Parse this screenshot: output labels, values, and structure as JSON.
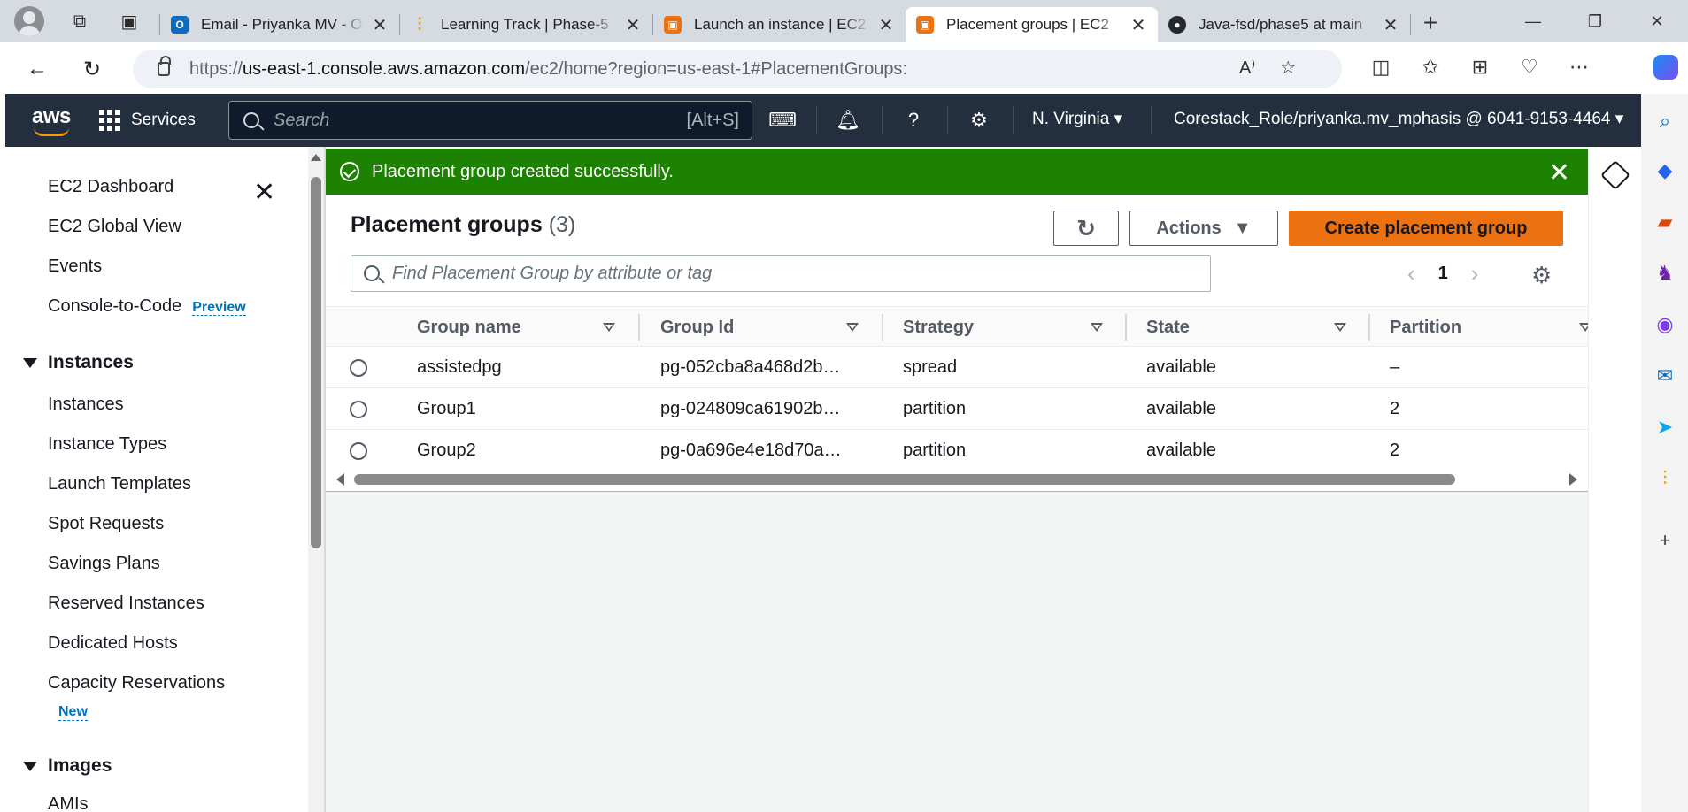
{
  "browser": {
    "tabs": [
      {
        "title": "Email - Priyanka MV - Outlook",
        "favicon": "outlook-icon",
        "color": "#0f6cbd"
      },
      {
        "title": "Learning Track | Phase-5",
        "favicon": "learning-icon",
        "color": "#e5a50a"
      },
      {
        "title": "Launch an instance | EC2",
        "favicon": "ec2-icon",
        "color": "#ec7211"
      },
      {
        "title": "Placement groups | EC2",
        "favicon": "ec2-icon",
        "color": "#ec7211"
      },
      {
        "title": "Java-fsd/phase5 at main",
        "favicon": "github-icon",
        "color": "#24292f"
      }
    ],
    "url_prefix": "https://",
    "url_host": "us-east-1.console.aws.amazon.com",
    "url_path": "/ec2/home?region=us-east-1#PlacementGroups:"
  },
  "aws_header": {
    "logo": "aws",
    "services_label": "Services",
    "search_placeholder": "Search",
    "search_shortcut": "[Alt+S]",
    "region": "N. Virginia",
    "account": "Corestack_Role/priyanka.mv_mphasis @ 6041-9153-4464"
  },
  "sidebar": {
    "items_top": [
      {
        "label": "EC2 Dashboard"
      },
      {
        "label": "EC2 Global View"
      },
      {
        "label": "Events"
      },
      {
        "label": "Console-to-Code",
        "badge": "Preview"
      }
    ],
    "section_instances": "Instances",
    "instances_items": [
      {
        "label": "Instances"
      },
      {
        "label": "Instance Types"
      },
      {
        "label": "Launch Templates"
      },
      {
        "label": "Spot Requests"
      },
      {
        "label": "Savings Plans"
      },
      {
        "label": "Reserved Instances"
      },
      {
        "label": "Dedicated Hosts"
      },
      {
        "label": "Capacity Reservations",
        "badge": "New"
      }
    ],
    "section_images": "Images",
    "images_items": [
      {
        "label": "AMIs"
      }
    ]
  },
  "flash": {
    "message": "Placement group created successfully."
  },
  "panel": {
    "title": "Placement groups",
    "count": "(3)",
    "actions_label": "Actions",
    "create_label": "Create placement group",
    "filter_placeholder": "Find Placement Group by attribute or tag",
    "page": "1"
  },
  "table": {
    "columns": [
      "Group name",
      "Group Id",
      "Strategy",
      "State",
      "Partition"
    ],
    "rows": [
      {
        "name": "assistedpg",
        "id": "pg-052cba8a468d2b…",
        "strategy": "spread",
        "state": "available",
        "partition": "–"
      },
      {
        "name": "Group1",
        "id": "pg-024809ca61902b…",
        "strategy": "partition",
        "state": "available",
        "partition": "2"
      },
      {
        "name": "Group2",
        "id": "pg-0a696e4e18d70a…",
        "strategy": "partition",
        "state": "available",
        "partition": "2"
      }
    ]
  },
  "colors": {
    "aws_header": "#232f3e",
    "success": "#1d8102",
    "primary_button": "#ec7211",
    "link": "#0073bb"
  }
}
